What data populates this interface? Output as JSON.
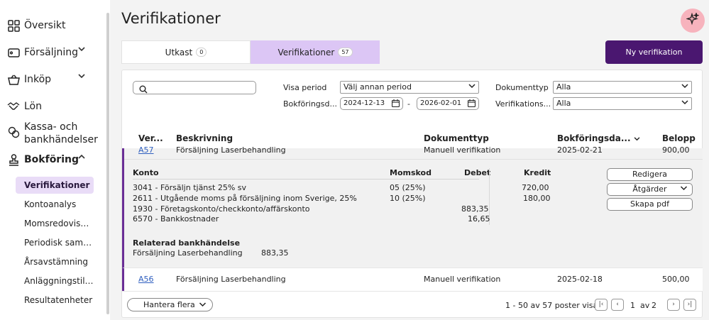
{
  "sidebar": {
    "items": [
      {
        "label": "Översikt",
        "icon": "grid-icon"
      },
      {
        "label": "Försäljning",
        "icon": "wallet-icon",
        "chevron": "⌄"
      },
      {
        "label": "Inköp",
        "icon": "basket-icon",
        "chevron": "⌄"
      },
      {
        "label": "Lön",
        "icon": "handshake-icon"
      },
      {
        "label_line1": "Kassa- och",
        "label_line2": "bankhändelser",
        "icon": "coins-icon"
      },
      {
        "label": "Bokföring",
        "icon": "stamp-icon",
        "chevron": "⌃"
      }
    ],
    "sub_items": [
      "Verifikationer",
      "Kontoanalys",
      "Momsredovisning",
      "Periodisk sammanställning",
      "Årsavstämning",
      "Anläggningstillgångar",
      "Resultatenheter"
    ]
  },
  "header": {
    "title": "Verifikationer"
  },
  "tabs": [
    {
      "label": "Utkast",
      "count": "0"
    },
    {
      "label": "Verifikationer",
      "count": "57"
    }
  ],
  "new_button": "Ny verifikation",
  "filters": {
    "visa_period_label": "Visa period",
    "visa_period_value": "Välj annan period",
    "bokforingsdatum_label": "Bokföringsd...",
    "date_from": "2024-12-13",
    "date_sep": "-",
    "date_to": "2026-02-01",
    "dokumenttyp_label": "Dokumenttyp",
    "dokumenttyp_value": "Alla",
    "verifikations_label": "Verifikations...",
    "verifikations_value": "Alla"
  },
  "table": {
    "headers": {
      "ver": "Ver...",
      "beskrivning": "Beskrivning",
      "dokumenttyp": "Dokumenttyp",
      "bokforingsdatum": "Bokföringsda...",
      "belopp": "Belopp"
    },
    "rows": [
      {
        "ver": "A57",
        "beskrivning": "Försäljning Laserbehandling",
        "dokumenttyp": "Manuell verifikation",
        "datum": "2025-02-21",
        "belopp": "900,00"
      },
      {
        "ver": "A56",
        "beskrivning": "Försäljning Laserbehandling",
        "dokumenttyp": "Manuell verifikation",
        "datum": "2025-02-18",
        "belopp": "500,00"
      }
    ]
  },
  "detail": {
    "headers": {
      "konto": "Konto",
      "momskod": "Momskod",
      "debet": "Debet",
      "kredit": "Kredit"
    },
    "lines": [
      {
        "konto": "3041 - Försäljn tjänst 25% sv",
        "momskod": "05 (25%)",
        "debet": "",
        "kredit": "720,00"
      },
      {
        "konto": "2611 - Utgående moms på försäljning inom Sverige, 25%",
        "momskod": "10 (25%)",
        "debet": "",
        "kredit": "180,00"
      },
      {
        "konto": "1930 - Företagskonto/checkkonto/affärskonto",
        "momskod": "",
        "debet": "883,35",
        "kredit": ""
      },
      {
        "konto": "6570 - Bankkostnader",
        "momskod": "",
        "debet": "16,65",
        "kredit": ""
      }
    ],
    "related_title": "Relaterad bankhändelse",
    "related_desc": "Försäljning Laserbehandling",
    "related_amount": "883,35",
    "actions": {
      "edit": "Redigera",
      "actions": "Åtgärder",
      "pdf": "Skapa pdf"
    }
  },
  "footer": {
    "manage": "Hantera flera",
    "range": "1 - 50 av 57 poster visas",
    "page": "1",
    "of": "av",
    "total_pages": "2"
  },
  "colors": {
    "accent": "#4a1770",
    "tab_active": "#dcc6f5",
    "sidebar_active": "#e9dcf7",
    "row_marker": "#6a2e96",
    "ai_button": "#f7b3bd",
    "link": "#2f5fbf"
  }
}
